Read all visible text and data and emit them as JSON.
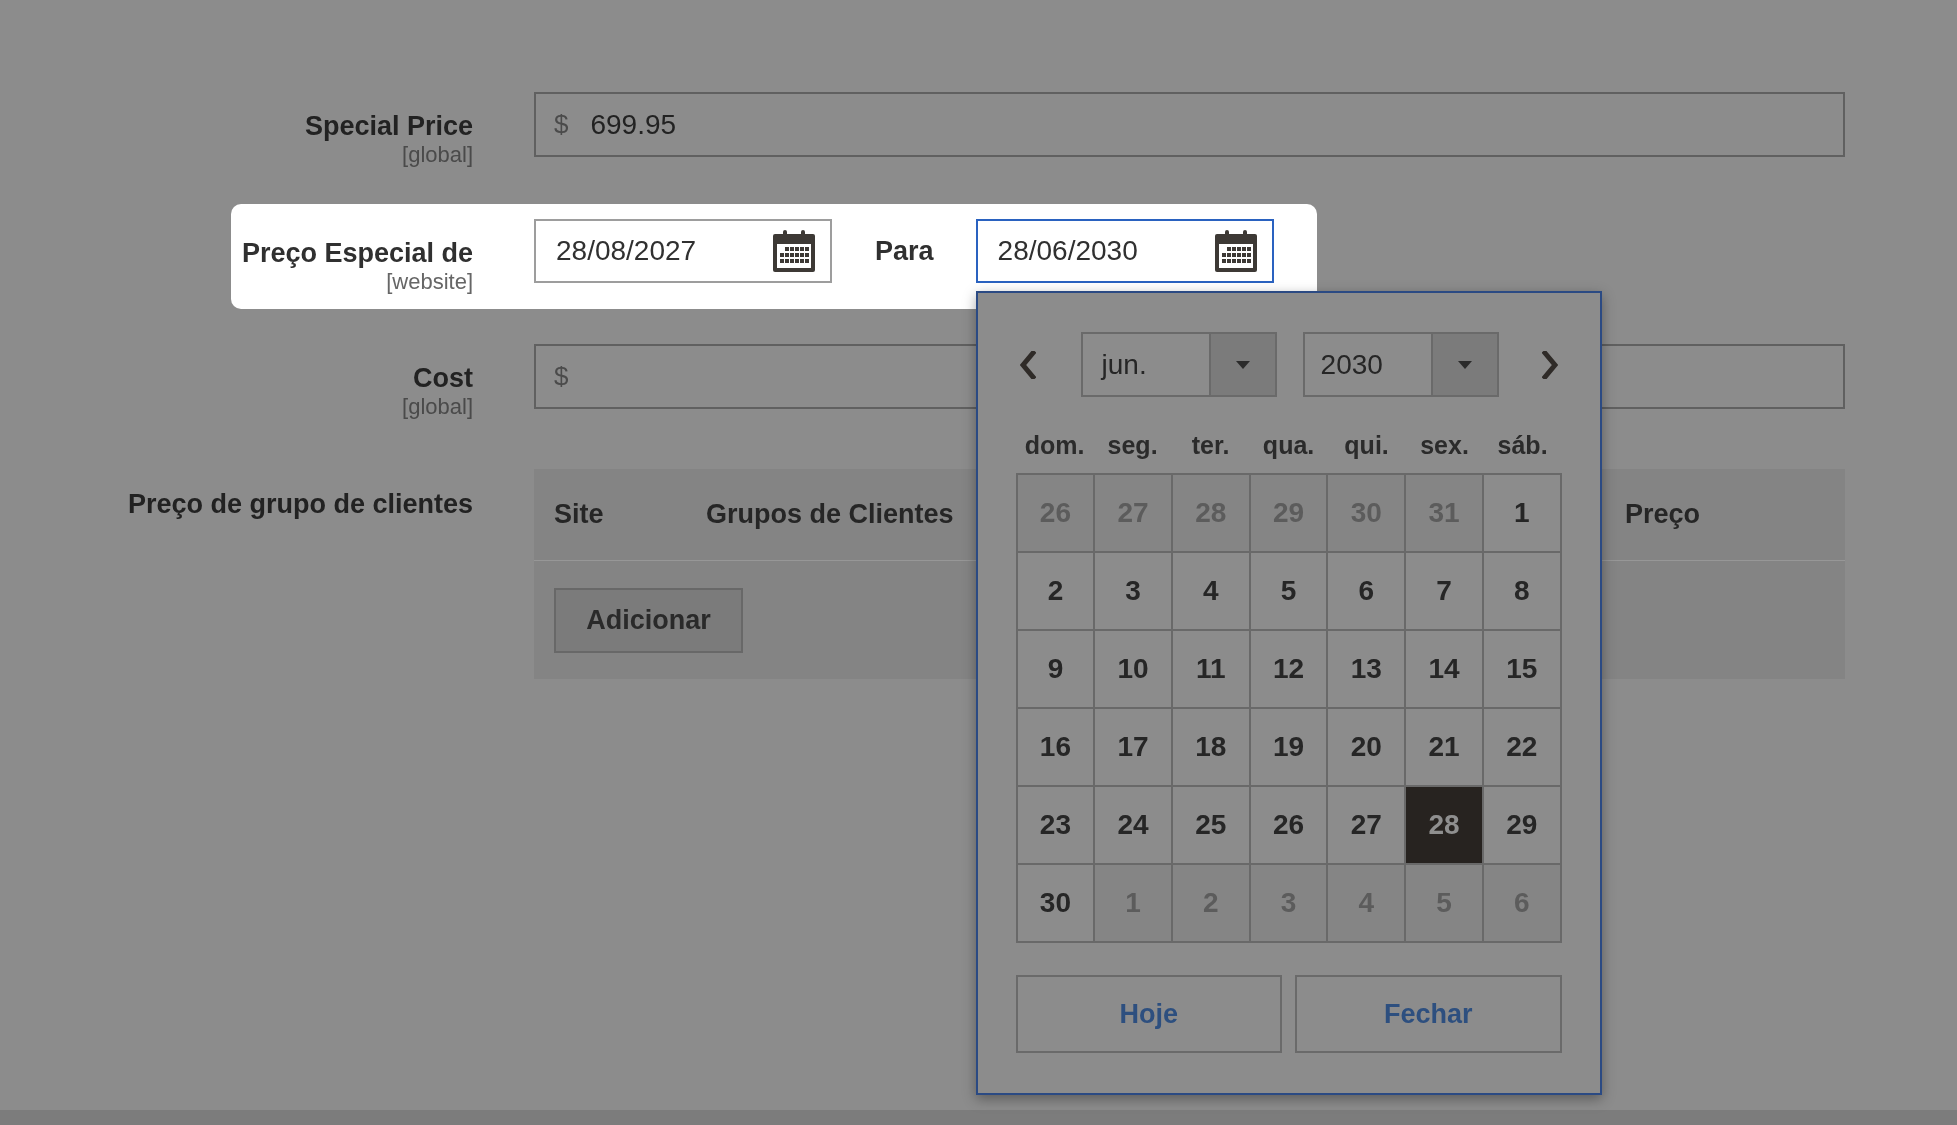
{
  "form": {
    "special_price": {
      "label": "Special Price",
      "scope": "[global]",
      "currency": "$",
      "value": "699.95"
    },
    "special_price_dates": {
      "highlighted": true,
      "label": "Preço Especial de",
      "scope": "[website]",
      "from": {
        "value": "28/08/2027",
        "focused": false
      },
      "to_label": "Para",
      "to": {
        "value": "28/06/2030",
        "focused": true
      }
    },
    "cost": {
      "label": "Cost",
      "scope": "[global]",
      "currency": "$"
    },
    "customer_group_price": {
      "label": "Preço de grupo de clientes",
      "columns": [
        "Site",
        "Grupos de Clientes",
        "Preço"
      ],
      "add_button": "Adicionar"
    }
  },
  "datepicker": {
    "month": "jun.",
    "year": "2030",
    "weekdays": [
      "dom.",
      "seg.",
      "ter.",
      "qua.",
      "qui.",
      "sex.",
      "sáb."
    ],
    "weeks": [
      [
        {
          "day": "26",
          "other_month": true,
          "selected": false
        },
        {
          "day": "27",
          "other_month": true,
          "selected": false
        },
        {
          "day": "28",
          "other_month": true,
          "selected": false
        },
        {
          "day": "29",
          "other_month": true,
          "selected": false
        },
        {
          "day": "30",
          "other_month": true,
          "selected": false
        },
        {
          "day": "31",
          "other_month": true,
          "selected": false
        },
        {
          "day": "1",
          "other_month": false,
          "selected": false
        }
      ],
      [
        {
          "day": "2",
          "other_month": false,
          "selected": false
        },
        {
          "day": "3",
          "other_month": false,
          "selected": false
        },
        {
          "day": "4",
          "other_month": false,
          "selected": false
        },
        {
          "day": "5",
          "other_month": false,
          "selected": false
        },
        {
          "day": "6",
          "other_month": false,
          "selected": false
        },
        {
          "day": "7",
          "other_month": false,
          "selected": false
        },
        {
          "day": "8",
          "other_month": false,
          "selected": false
        }
      ],
      [
        {
          "day": "9",
          "other_month": false,
          "selected": false
        },
        {
          "day": "10",
          "other_month": false,
          "selected": false
        },
        {
          "day": "11",
          "other_month": false,
          "selected": false
        },
        {
          "day": "12",
          "other_month": false,
          "selected": false
        },
        {
          "day": "13",
          "other_month": false,
          "selected": false
        },
        {
          "day": "14",
          "other_month": false,
          "selected": false
        },
        {
          "day": "15",
          "other_month": false,
          "selected": false
        }
      ],
      [
        {
          "day": "16",
          "other_month": false,
          "selected": false
        },
        {
          "day": "17",
          "other_month": false,
          "selected": false
        },
        {
          "day": "18",
          "other_month": false,
          "selected": false
        },
        {
          "day": "19",
          "other_month": false,
          "selected": false
        },
        {
          "day": "20",
          "other_month": false,
          "selected": false
        },
        {
          "day": "21",
          "other_month": false,
          "selected": false
        },
        {
          "day": "22",
          "other_month": false,
          "selected": false
        }
      ],
      [
        {
          "day": "23",
          "other_month": false,
          "selected": false
        },
        {
          "day": "24",
          "other_month": false,
          "selected": false
        },
        {
          "day": "25",
          "other_month": false,
          "selected": false
        },
        {
          "day": "26",
          "other_month": false,
          "selected": false
        },
        {
          "day": "27",
          "other_month": false,
          "selected": false
        },
        {
          "day": "28",
          "other_month": false,
          "selected": true
        },
        {
          "day": "29",
          "other_month": false,
          "selected": false
        }
      ],
      [
        {
          "day": "30",
          "other_month": false,
          "selected": false
        },
        {
          "day": "1",
          "other_month": true,
          "selected": false
        },
        {
          "day": "2",
          "other_month": true,
          "selected": false
        },
        {
          "day": "3",
          "other_month": true,
          "selected": false
        },
        {
          "day": "4",
          "other_month": true,
          "selected": false
        },
        {
          "day": "5",
          "other_month": true,
          "selected": false
        },
        {
          "day": "6",
          "other_month": true,
          "selected": false
        }
      ]
    ],
    "buttons": [
      "Hoje",
      "Fechar"
    ]
  }
}
